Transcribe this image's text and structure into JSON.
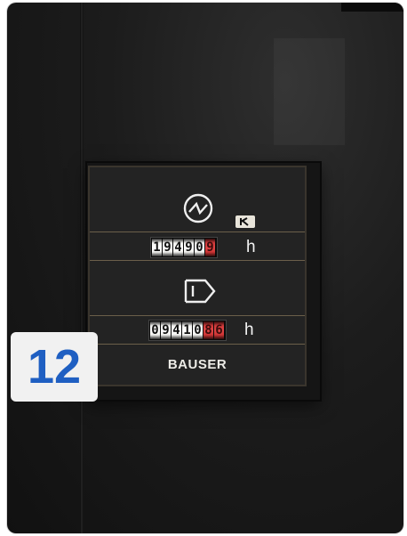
{
  "badge": {
    "number": "12"
  },
  "meter": {
    "brand": "BAUSER",
    "counter_top": {
      "digits": [
        "1",
        "9",
        "4",
        "9",
        "0",
        "9"
      ],
      "red_from_index": 5,
      "unit": "h"
    },
    "counter_bottom": {
      "digits": [
        "0",
        "9",
        "4",
        "1",
        "0",
        "8",
        "6"
      ],
      "red_from_index": 5,
      "unit": "h"
    },
    "icons": [
      "clock-symbol-icon",
      "k-tag-icon",
      "load-arrow-icon"
    ]
  },
  "colors": {
    "badge_text": "#1f5fc2",
    "badge_bg": "#f1f1f1",
    "red_digits": "#d23a3a"
  }
}
